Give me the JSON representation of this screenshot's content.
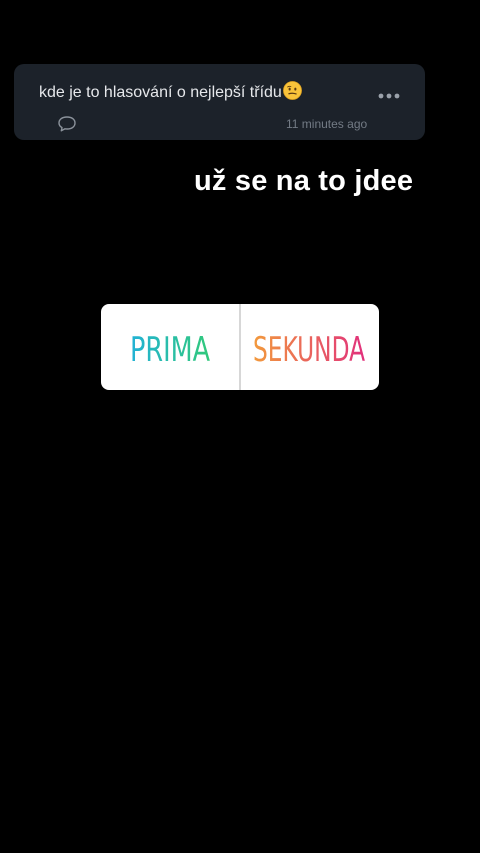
{
  "comment": {
    "text": "kde je to hlasování o nejlepší třídu",
    "emoji": "neutral-face-emoji",
    "timestamp": "11 minutes ago",
    "more_icon": "more-horizontal-icon",
    "reply_icon": "speech-bubble-icon"
  },
  "caption": {
    "text": "už se na to jdee"
  },
  "poll": {
    "option_a": "PRIMA",
    "option_b": "SEKUNDA",
    "colors": {
      "a_start": "#22b2d6",
      "a_end": "#31c97a",
      "b_start": "#f29a3c",
      "b_end": "#e1307c",
      "card_bg": "#1c222a"
    }
  }
}
